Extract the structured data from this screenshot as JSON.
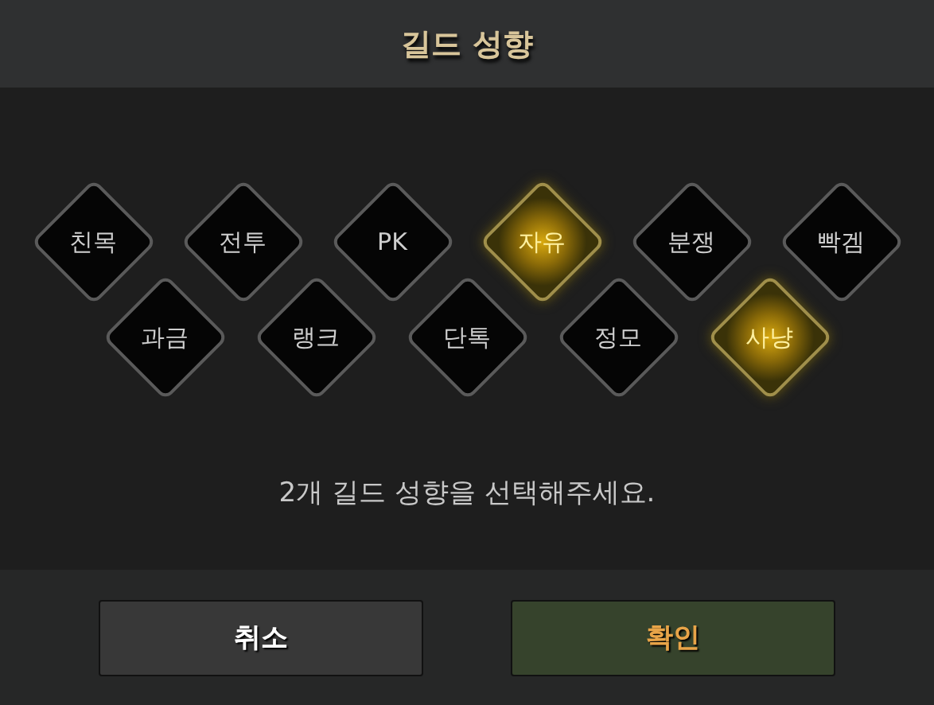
{
  "window": {
    "title": "길드 성향"
  },
  "tendencies": [
    [
      {
        "label": "친목",
        "selected": false
      },
      {
        "label": "전투",
        "selected": false
      },
      {
        "label": "PK",
        "selected": false
      },
      {
        "label": "자유",
        "selected": true
      },
      {
        "label": "분쟁",
        "selected": false
      },
      {
        "label": "빡겜",
        "selected": false
      }
    ],
    [
      {
        "label": "과금",
        "selected": false
      },
      {
        "label": "랭크",
        "selected": false
      },
      {
        "label": "단톡",
        "selected": false
      },
      {
        "label": "정모",
        "selected": false
      },
      {
        "label": "사냥",
        "selected": true
      }
    ]
  ],
  "hint": "2개 길드 성향을 선택해주세요.",
  "buttons": [
    {
      "label": "취소",
      "kind": "cancel"
    },
    {
      "label": "확인",
      "kind": "confirm"
    }
  ]
}
